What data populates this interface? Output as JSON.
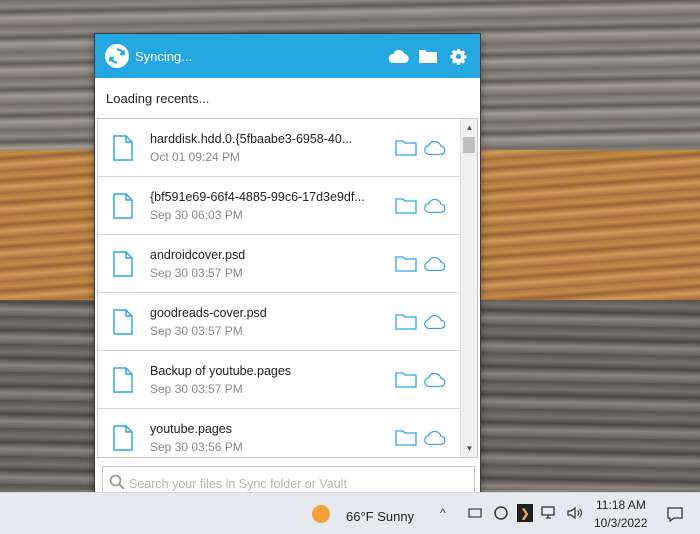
{
  "sync": {
    "status": "Syncing...",
    "recents_label": "Loading recents...",
    "search_placeholder": "Search your files in Sync folder or Vault",
    "accent_color": "#25a8e2",
    "files": [
      {
        "name": "harddisk.hdd.0.{5fbaabe3-6958-40...",
        "date": "Oct 01 09:24 PM"
      },
      {
        "name": "{bf591e69-66f4-4885-99c6-17d3e9df...",
        "date": "Sep 30 06:03 PM"
      },
      {
        "name": "androidcover.psd",
        "date": "Sep 30 03:57 PM"
      },
      {
        "name": "goodreads-cover.psd",
        "date": "Sep 30 03:57 PM"
      },
      {
        "name": "Backup of youtube.pages",
        "date": "Sep 30 03:57 PM"
      },
      {
        "name": "youtube.pages",
        "date": "Sep 30 03:56 PM"
      }
    ]
  },
  "taskbar": {
    "weather": "66°F  Sunny",
    "time": "11:18 AM",
    "date": "10/3/2022"
  }
}
